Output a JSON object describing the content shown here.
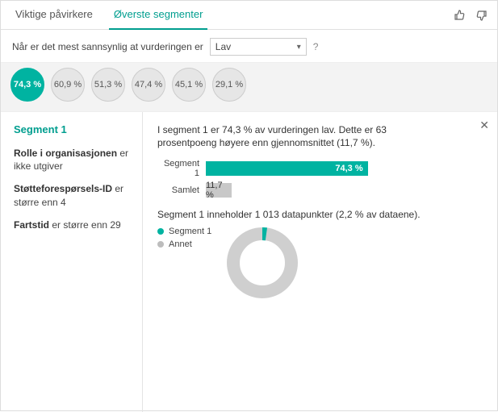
{
  "tabs": {
    "influencers": "Viktige påvirkere",
    "segments": "Øverste segmenter"
  },
  "question": {
    "prefix": "Når er det mest sannsynlig at vurderingen er",
    "selected": "Lav",
    "help": "?"
  },
  "bubbles": [
    {
      "label": "74,3 %",
      "value": 74.3,
      "active": true
    },
    {
      "label": "60,9 %",
      "value": 60.9,
      "active": false
    },
    {
      "label": "51,3 %",
      "value": 51.3,
      "active": false
    },
    {
      "label": "47,4 %",
      "value": 47.4,
      "active": false
    },
    {
      "label": "45,1 %",
      "value": 45.1,
      "active": false
    },
    {
      "label": "29,1 %",
      "value": 29.1,
      "active": false
    }
  ],
  "side": {
    "title": "Segment 1",
    "rules": [
      {
        "field": "Rolle i organisasjonen",
        "op": "er ikke utgiver"
      },
      {
        "field": "Støtteforespørsels-ID",
        "op": "er større enn 4"
      },
      {
        "field": "Fartstid",
        "op": "er større enn 29"
      }
    ]
  },
  "detail": {
    "headline": "I segment 1 er 74,3 % av vurderingen lav. Dette er 63 prosentpoeng høyere enn gjennomsnittet (11,7 %).",
    "bars": {
      "seg_label": "Segment 1",
      "seg_val_label": "74,3 %",
      "overall_label": "Samlet",
      "overall_val_label": "11,7 %"
    },
    "countline": "Segment 1 inneholder 1 013 datapunkter (2,2 % av dataene).",
    "legend": {
      "segment": "Segment 1",
      "other": "Annet"
    }
  },
  "chart_data": [
    {
      "type": "bar",
      "title": "Andel med lav vurdering",
      "categories": [
        "Segment 1",
        "Samlet"
      ],
      "values": [
        74.3,
        11.7
      ],
      "xlabel": "",
      "ylabel": "%",
      "ylim": [
        0,
        100
      ]
    },
    {
      "type": "pie",
      "title": "Andel av dataene",
      "series": [
        {
          "name": "Segment 1",
          "value": 2.2
        },
        {
          "name": "Annet",
          "value": 97.8
        }
      ]
    }
  ],
  "colors": {
    "accent": "#00b3a1",
    "grey": "#c8c8c8"
  }
}
